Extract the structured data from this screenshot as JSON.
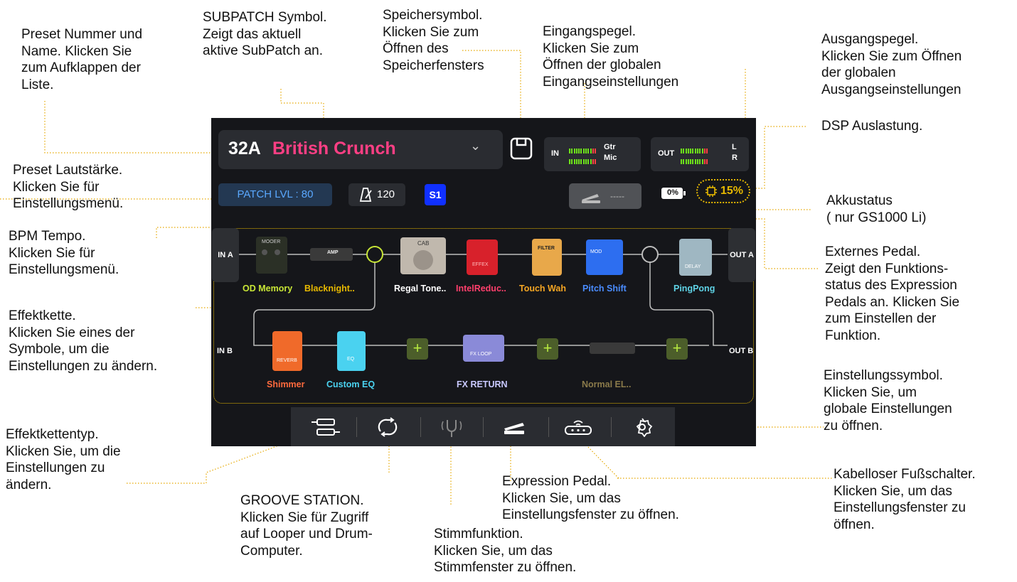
{
  "annotations": {
    "preset": "Preset Nummer und\nName. Klicken Sie\nzum Aufklappen der\nListe.",
    "subpatch": "SUBPATCH Symbol.\nZeigt das aktuell\naktive SubPatch an.",
    "save": "Speichersymbol.\nKlicken Sie zum\nÖffnen des\nSpeicherfensters",
    "input": "Eingangspegel.\nKlicken Sie zum\nÖffnen der globalen\nEingangseinstellungen",
    "output": "Ausgangspegel.\nKlicken Sie zum Öffnen\nder globalen\nAusgangseinstellungen",
    "dsp": "DSP Auslastung.",
    "volume": "Preset Lautstärke.\nKlicken Sie für\nEinstellungsmenü.",
    "battery": "Akkustatus\n( nur GS1000 Li)",
    "bpm": "BPM Tempo.\nKlicken Sie für\nEinstellungsmenü.",
    "extpedal": "Externes Pedal.\nZeigt den Funktions-\nstatus des Expression\nPedals an. Klicken Sie\nzum Einstellen der\nFunktion.",
    "chain": "Effektkette.\nKlicken Sie eines der\nSymbole, um die\nEinstellungen zu ändern.",
    "settings": "Einstellungssymbol.\nKlicken Sie, um\nglobale Einstellungen\nzu öffnen.",
    "chaintype": "Effektkettentyp.\nKlicken Sie, um die\nEinstellungen zu\nändern.",
    "groove": "GROOVE STATION.\nKlicken Sie für Zugriff\nauf Looper und Drum-\nComputer.",
    "exppedal": "Expression Pedal.\nKlicken Sie, um das\nEinstellungsfenster zu öffnen.",
    "wireless": "Kabelloser Fußschalter.\nKlicken Sie, um das\nEinstellungsfenster zu\nöffnen.",
    "tuner": "Stimmfunktion.\nKlicken Sie, um das\nStimmfenster zu öffnen."
  },
  "screen": {
    "preset_number": "32A",
    "preset_name": "British Crunch",
    "in_label": "IN",
    "in_ch1": "Gtr",
    "in_ch2": "Mic",
    "out_label": "OUT",
    "out_ch1": "L",
    "out_ch2": "R",
    "patch_level": "PATCH LVL : 80",
    "bpm": "120",
    "subpatch": "S1",
    "ext_pedal_value": "-----",
    "battery": "0%",
    "dsp": "15%",
    "in_a": "IN A",
    "out_a": "OUT A",
    "in_b": "IN B",
    "out_b": "OUT B",
    "row_a": [
      {
        "name": "OD Memory",
        "color": "#c8e636",
        "pedal_text": "MOOER"
      },
      {
        "name": "Blacknight..",
        "color": "#e6b800",
        "pedal_text": "AMP"
      },
      {
        "name": "Regal Tone..",
        "color": "#ffffff",
        "pedal_text": "CAB"
      },
      {
        "name": "IntelReduc..",
        "color": "#ff3f6c",
        "pedal_text": "EFFEX"
      },
      {
        "name": "Touch Wah",
        "color": "#f5a623",
        "pedal_text": "FILTER"
      },
      {
        "name": "Pitch Shift",
        "color": "#4a8cff",
        "pedal_text": "MOD"
      },
      {
        "name": "PingPong",
        "color": "#5fd3e6",
        "pedal_text": "DELAY"
      }
    ],
    "row_b": [
      {
        "name": "Shimmer",
        "color": "#ff6a3d",
        "pedal_text": "REVERB"
      },
      {
        "name": "Custom EQ",
        "color": "#4ad2f0",
        "pedal_text": "EQ"
      },
      {
        "name": "FX RETURN",
        "color": "#c9c9ff",
        "pedal_text": "FX LOOP"
      },
      {
        "name": "Normal EL..",
        "color": "#8a7a4a",
        "pedal_text": ""
      }
    ]
  }
}
